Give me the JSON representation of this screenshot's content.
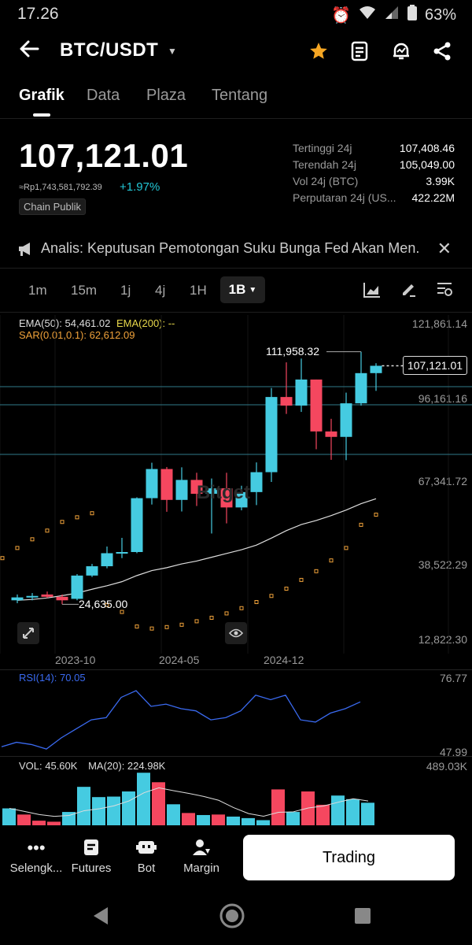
{
  "status": {
    "time": "17.26",
    "battery": "63%"
  },
  "header": {
    "pair": "BTC/USDT"
  },
  "tabs": [
    "Grafik",
    "Data",
    "Plaza",
    "Tentang"
  ],
  "price": {
    "last": "107,121.01",
    "fiat": "≈Rp1,743,581,792.39",
    "change": "+1.97%",
    "chain": "Chain Publik"
  },
  "stats": [
    {
      "label": "Tertinggi 24j",
      "value": "107,408.46"
    },
    {
      "label": "Terendah 24j",
      "value": "105,049.00"
    },
    {
      "label": "Vol 24j (BTC)",
      "value": "3.99K"
    },
    {
      "label": "Perputaran 24j (US...",
      "value": "422.22M"
    }
  ],
  "news": {
    "text": "Analis: Keputusan Pemotongan Suku Bunga Fed Akan Men..."
  },
  "timeframes": [
    "1m",
    "15m",
    "1j",
    "4j",
    "1H",
    "1B"
  ],
  "chart": {
    "ema_legend": "EMA(50): 54,461.02",
    "ema200_legend": "EMA(200): --",
    "sar_legend": "SAR(0.01,0.1): 62,612.09",
    "price_axis": [
      "121,861.14",
      "96,161.16",
      "67,341.72",
      "38,522.29",
      "12,822.30"
    ],
    "time_axis": [
      "2023-10",
      "2024-05",
      "2024-12"
    ],
    "high_label": "111,958.32",
    "low_label": "24,635.00",
    "current_label": "107,121.01",
    "watermark": "Bitget",
    "rsi_legend": "RSI(14): 70.05",
    "rsi_axis": [
      "76.77",
      "47.99"
    ],
    "vol_legend": "VOL: 45.60K",
    "vol_ma_legend": "MA(20): 224.98K",
    "vol_axis": "489.03K"
  },
  "chart_data": {
    "type": "candlestick",
    "ylim": [
      12822.3,
      121861.14
    ],
    "candles": [
      {
        "o": 26000,
        "h": 28000,
        "l": 25000,
        "c": 27000
      },
      {
        "o": 27000,
        "h": 28500,
        "l": 26000,
        "c": 27500
      },
      {
        "o": 28000,
        "h": 29000,
        "l": 26800,
        "c": 27200
      },
      {
        "o": 27200,
        "h": 28000,
        "l": 24635,
        "c": 26000
      },
      {
        "o": 26500,
        "h": 35000,
        "l": 26000,
        "c": 34500
      },
      {
        "o": 34500,
        "h": 38500,
        "l": 34000,
        "c": 37700
      },
      {
        "o": 37700,
        "h": 44500,
        "l": 37000,
        "c": 42200
      },
      {
        "o": 42200,
        "h": 47500,
        "l": 40500,
        "c": 42600
      },
      {
        "o": 42600,
        "h": 61500,
        "l": 42200,
        "c": 61200
      },
      {
        "o": 61200,
        "h": 73500,
        "l": 59000,
        "c": 71300
      },
      {
        "o": 71300,
        "h": 72000,
        "l": 56500,
        "c": 60600
      },
      {
        "o": 60600,
        "h": 71900,
        "l": 56600,
        "c": 67500
      },
      {
        "o": 67500,
        "h": 70000,
        "l": 58500,
        "c": 62700
      },
      {
        "o": 62700,
        "h": 68000,
        "l": 49000,
        "c": 64600
      },
      {
        "o": 64600,
        "h": 70000,
        "l": 52500,
        "c": 58000
      },
      {
        "o": 58000,
        "h": 65500,
        "l": 57000,
        "c": 63300
      },
      {
        "o": 63300,
        "h": 73600,
        "l": 58800,
        "c": 70200
      },
      {
        "o": 70200,
        "h": 99500,
        "l": 66800,
        "c": 96400
      },
      {
        "o": 96400,
        "h": 108300,
        "l": 90500,
        "c": 93400
      },
      {
        "o": 93400,
        "h": 109600,
        "l": 91200,
        "c": 102400
      },
      {
        "o": 102400,
        "h": 102400,
        "l": 78200,
        "c": 84400
      },
      {
        "o": 84400,
        "h": 88800,
        "l": 74500,
        "c": 82500
      },
      {
        "o": 82500,
        "h": 97900,
        "l": 74400,
        "c": 94200
      },
      {
        "o": 94200,
        "h": 111958,
        "l": 93400,
        "c": 104600
      },
      {
        "o": 104600,
        "h": 108000,
        "l": 98500,
        "c": 107121
      }
    ],
    "ema50": [
      26000,
      26300,
      26800,
      27600,
      28500,
      29800,
      31000,
      32400,
      34500,
      36200,
      37200,
      38500,
      39500,
      40800,
      42100,
      43400,
      45000,
      47400,
      50000,
      52100,
      53500,
      55200,
      57100,
      59300,
      61000
    ],
    "sar": [
      40500,
      44000,
      47000,
      50000,
      53000,
      54600,
      56000,
      24400,
      22000,
      17000,
      16300,
      16800,
      17600,
      18800,
      20000,
      21500,
      23300,
      25400,
      27500,
      30000,
      33000,
      36000,
      39700,
      44000,
      52000,
      55500,
      58000
    ],
    "rsi": [
      50,
      52,
      51,
      49,
      54,
      58,
      62,
      63,
      72,
      75,
      68,
      69,
      67,
      66,
      62,
      63,
      66,
      73,
      71,
      73,
      62,
      61,
      65,
      67,
      70
    ],
    "volume": [
      66,
      42,
      18,
      14,
      52,
      150,
      110,
      112,
      132,
      205,
      168,
      82,
      48,
      40,
      42,
      34,
      28,
      20,
      140,
      52,
      132,
      80,
      116,
      102,
      88
    ],
    "volume_rising": [
      true,
      false,
      false,
      false,
      true,
      true,
      true,
      true,
      true,
      true,
      false,
      true,
      false,
      true,
      false,
      true,
      true,
      true,
      false,
      true,
      false,
      false,
      true,
      true,
      true
    ]
  },
  "bottom_nav": [
    "Selengk...",
    "Futures",
    "Bot",
    "Margin"
  ],
  "trade_button": "Trading",
  "colors": {
    "up": "#45cbe1",
    "down": "#f5475f",
    "accent": "#23c7d6",
    "star": "#f5a623"
  }
}
